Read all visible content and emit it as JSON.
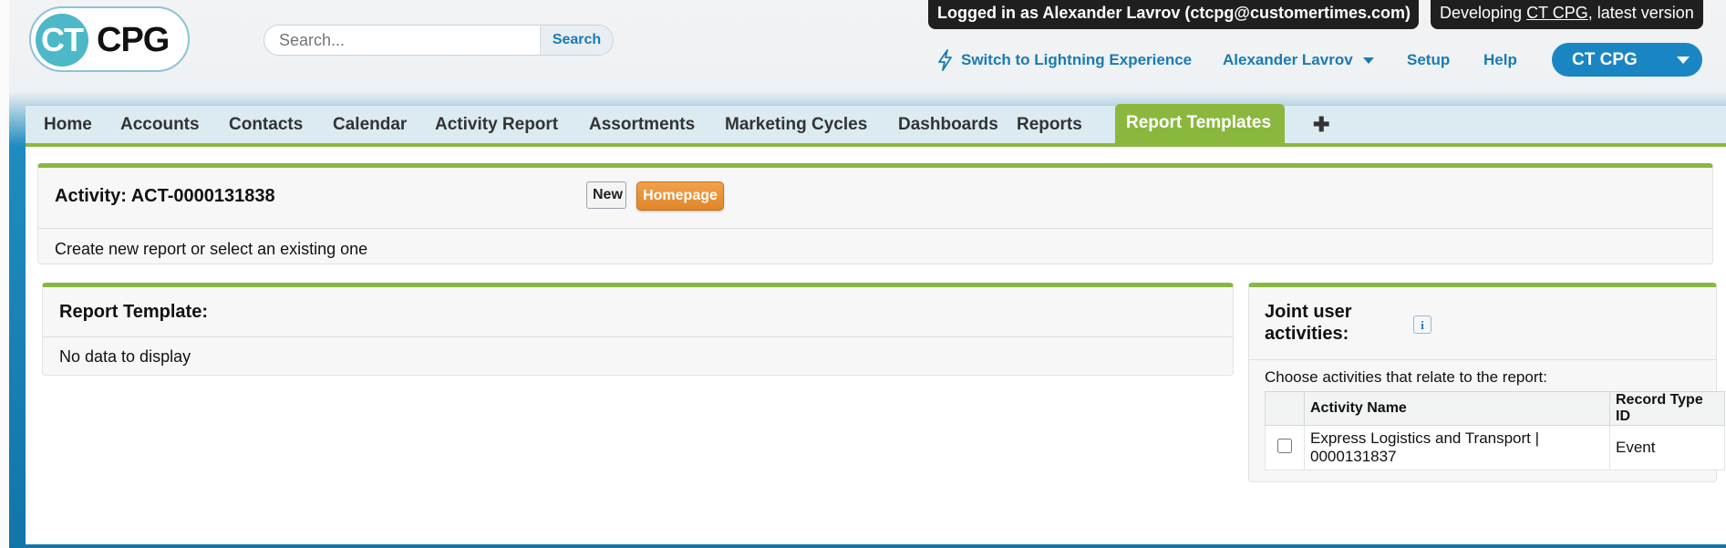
{
  "header": {
    "logo_mark": "CT",
    "logo_text": "CPG",
    "search_placeholder": "Search...",
    "search_button": "Search",
    "login_banner": "Logged in as Alexander Lavrov (ctcpg@customertimes.com)",
    "dev_prefix": "Developing ",
    "dev_link": "CT CPG",
    "dev_suffix": ", latest version",
    "links": {
      "lightning": "Switch to Lightning Experience",
      "user": "Alexander Lavrov",
      "setup": "Setup",
      "help": "Help"
    },
    "app_switcher": "CT CPG"
  },
  "tabs": [
    {
      "label": "Home"
    },
    {
      "label": "Accounts"
    },
    {
      "label": "Contacts"
    },
    {
      "label": "Calendar"
    },
    {
      "label": "Activity Report"
    },
    {
      "label": "Assortments"
    },
    {
      "label": "Marketing Cycles"
    },
    {
      "label": "Dashboards"
    },
    {
      "label": "Reports"
    },
    {
      "label": "Report Templates",
      "active": true
    },
    {
      "label": "✚"
    }
  ],
  "activity_panel": {
    "title": "Activity: ACT-0000131838",
    "new_button": "New",
    "homepage_button": "Homepage",
    "description": "Create new report or select an existing one"
  },
  "report_template_panel": {
    "title": "Report Template:",
    "empty_text": "No data to display"
  },
  "joint_panel": {
    "title_line1": "Joint user",
    "title_line2": "activities:",
    "info_icon": "i",
    "prompt": "Choose activities that relate to the report:",
    "columns": [
      "Activity Name",
      "Record Type ID"
    ],
    "rows": [
      {
        "name_line1": "Express Logistics and Transport |",
        "name_line2": "0000131837",
        "record_type": "Event",
        "checked": false
      }
    ]
  },
  "colors": {
    "accent_green": "#8ab83f",
    "link_blue": "#1a7bb0",
    "app_button_blue": "#1a85c3",
    "homepage_orange": "#e0862a"
  }
}
